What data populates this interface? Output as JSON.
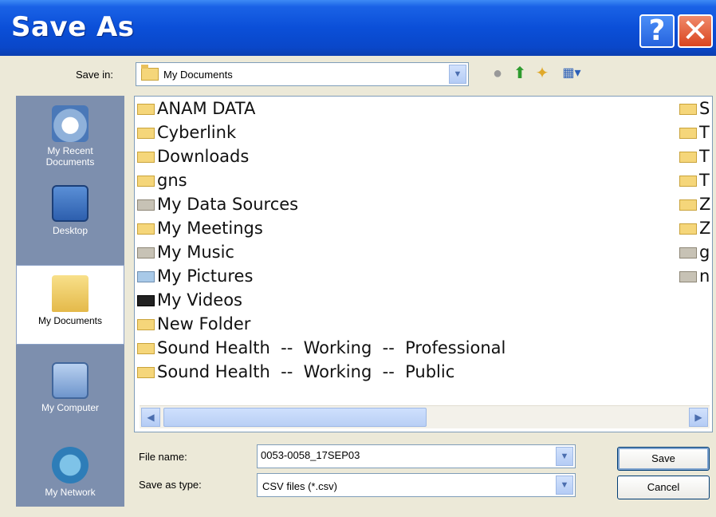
{
  "window": {
    "title": "Save As",
    "help_glyph": "?",
    "close_glyph": "✕"
  },
  "toolbar": {
    "save_in_label": "Save in:",
    "save_in_value": "My Documents"
  },
  "places": [
    {
      "name": "My Recent Documents",
      "line1": "My Recent",
      "line2": "Documents"
    },
    {
      "name": "Desktop",
      "line1": "Desktop",
      "line2": ""
    },
    {
      "name": "My Documents",
      "line1": "My Documents",
      "line2": "",
      "selected": true
    },
    {
      "name": "My Computer",
      "line1": "My Computer",
      "line2": ""
    },
    {
      "name": "My Network",
      "line1": "My Network",
      "line2": ""
    }
  ],
  "files_left": [
    "ANAM DATA",
    "Cyberlink",
    "Downloads",
    "gns",
    "My Data Sources",
    "My Meetings",
    "My Music",
    "My Pictures",
    "My Videos",
    "New Folder",
    "Sound Health  --  Working  --  Professional",
    "Sound Health  --  Working  --  Public"
  ],
  "files_right": [
    "S",
    "T",
    "T",
    "T",
    "Z",
    "Z",
    "g",
    "n"
  ],
  "form": {
    "file_name_label": "File name:",
    "file_name_value": "0053-0058_17SEP03",
    "save_type_label": "Save as type:",
    "save_type_value": "CSV files (*.csv)"
  },
  "buttons": {
    "save": "Save",
    "cancel": "Cancel"
  }
}
